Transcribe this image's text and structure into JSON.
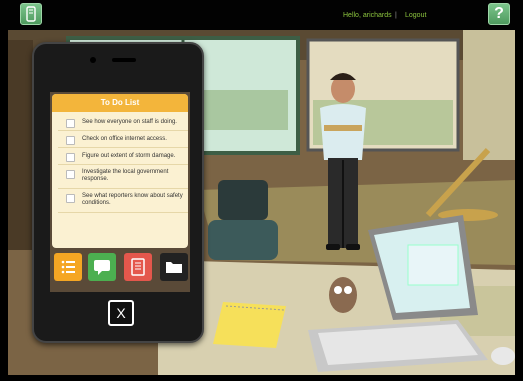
{
  "header": {
    "greeting": "Hello, arichards",
    "separator": "|",
    "logout": "Logout",
    "help": "?"
  },
  "phone": {
    "todo_title": "To Do List",
    "tasks": [
      "See how everyone on staff is doing.",
      "Check on office internet access.",
      "Figure out extent of storm damage.",
      "Investigate the local government response.",
      "See what reporters know about safety conditions."
    ],
    "apps": [
      {
        "name": "list-app",
        "color": "#f5a623"
      },
      {
        "name": "messages-app",
        "color": "#4caf50"
      },
      {
        "name": "notebook-app",
        "color": "#e4574c"
      },
      {
        "name": "folder-app",
        "color": "#222222"
      }
    ],
    "close": "X"
  }
}
